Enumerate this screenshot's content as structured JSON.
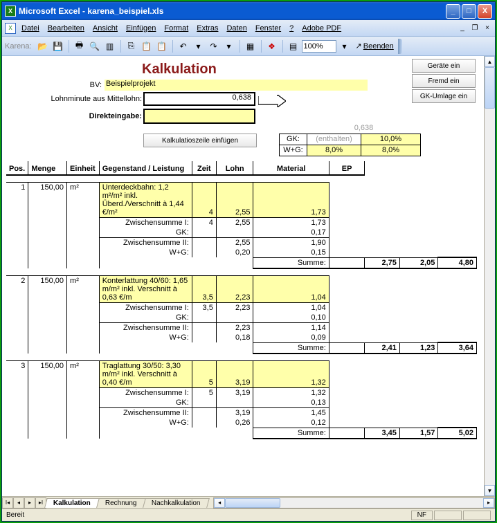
{
  "window": {
    "title": "Microsoft Excel - karena_beispiel.xls"
  },
  "menu": {
    "items": [
      "Datei",
      "Bearbeiten",
      "Ansicht",
      "Einfügen",
      "Format",
      "Extras",
      "Daten",
      "Fenster",
      "?",
      "Adobe PDF"
    ]
  },
  "toolbar": {
    "label": "Karena:",
    "zoom": "100%",
    "beenden": "Beenden"
  },
  "header": {
    "title": "Kalkulation",
    "bv_label": "BV:",
    "bv_value": "Beispielprojekt",
    "lohn_label": "Lohnminute aus Mittellohn:",
    "lohn_value": "0,638",
    "direkt_label": "Direkteingabe:",
    "insert_btn": "Kalkulatioszeile einfügen",
    "side_buttons": [
      "Geräte ein",
      "Fremd ein",
      "GK-Umlage ein"
    ],
    "small_val": "0,638",
    "gk": {
      "lbl1": "GK:",
      "lbl2": "W+G:",
      "enth": "(enthalten)",
      "p1": "10,0%",
      "p2": "8,0%",
      "p3": "8,0%"
    }
  },
  "columns": {
    "pos": "Pos.",
    "menge": "Menge",
    "einheit": "Einheit",
    "gegenstand": "Gegenstand / Leistung",
    "zeit": "Zeit",
    "lohn": "Lohn",
    "material": "Material",
    "ep": "EP"
  },
  "labels": {
    "zw1": "Zwischensumme I:",
    "gk": "GK:",
    "zw2": "Zwischensumme II:",
    "wg": "W+G:",
    "sum": "Summe:"
  },
  "rows": [
    {
      "pos": "1",
      "menge": "150,00",
      "einheit": "m²",
      "desc": "Unterdeckbahn: 1,2 m²/m² inkl. Überd./Verschnitt à 1,44 €/m²",
      "zeit": "4",
      "lohn": "2,55",
      "mat": "1,73",
      "zw1": {
        "zeit": "4",
        "lohn": "2,55",
        "mat": "1,73"
      },
      "gk": {
        "mat": "0,17"
      },
      "zw2": {
        "lohn": "2,55",
        "mat": "1,90"
      },
      "wg": {
        "lohn": "0,20",
        "mat": "0,15"
      },
      "sum": {
        "lohn": "2,75",
        "mat": "2,05",
        "ep": "4,80"
      }
    },
    {
      "pos": "2",
      "menge": "150,00",
      "einheit": "m²",
      "desc": "Konterlattung 40/60: 1,65 m/m² inkl. Verschnitt à 0,63 €/m",
      "zeit": "3,5",
      "lohn": "2,23",
      "mat": "1,04",
      "zw1": {
        "zeit": "3,5",
        "lohn": "2,23",
        "mat": "1,04"
      },
      "gk": {
        "mat": "0,10"
      },
      "zw2": {
        "lohn": "2,23",
        "mat": "1,14"
      },
      "wg": {
        "lohn": "0,18",
        "mat": "0,09"
      },
      "sum": {
        "lohn": "2,41",
        "mat": "1,23",
        "ep": "3,64"
      }
    },
    {
      "pos": "3",
      "menge": "150,00",
      "einheit": "m²",
      "desc": "Traglattung 30/50: 3,30 m/m² inkl. Verschnitt à 0,40 €/m",
      "zeit": "5",
      "lohn": "3,19",
      "mat": "1,32",
      "zw1": {
        "zeit": "5",
        "lohn": "3,19",
        "mat": "1,32"
      },
      "gk": {
        "mat": "0,13"
      },
      "zw2": {
        "lohn": "3,19",
        "mat": "1,45"
      },
      "wg": {
        "lohn": "0,26",
        "mat": "0,12"
      },
      "sum": {
        "lohn": "3,45",
        "mat": "1,57",
        "ep": "5,02"
      }
    }
  ],
  "tabs": [
    "Kalkulation",
    "Rechnung",
    "Nachkalkulation"
  ],
  "status": {
    "ready": "Bereit",
    "nf": "NF"
  }
}
